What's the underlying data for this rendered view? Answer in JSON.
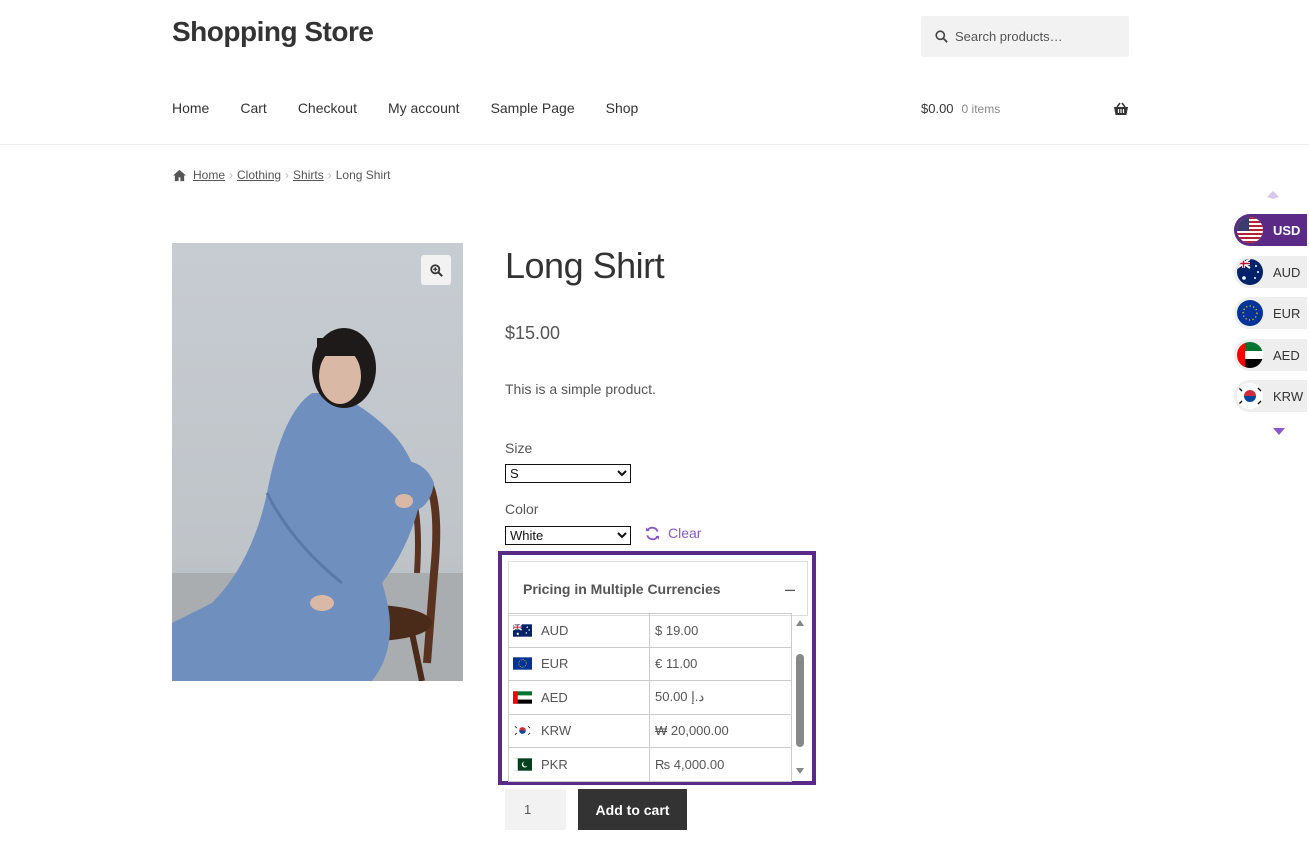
{
  "site": {
    "title": "Shopping Store"
  },
  "search": {
    "placeholder": "Search products…"
  },
  "nav": {
    "items": [
      "Home",
      "Cart",
      "Checkout",
      "My account",
      "Sample Page",
      "Shop"
    ]
  },
  "cart": {
    "amount": "$0.00",
    "count": "0 items"
  },
  "breadcrumb": {
    "home": "Home",
    "cat1": "Clothing",
    "cat2": "Shirts",
    "current": "Long Shirt"
  },
  "product": {
    "title": "Long Shirt",
    "price": "$15.00",
    "description": "This is a simple product.",
    "size_label": "Size",
    "size_value": "S",
    "color_label": "Color",
    "color_value": "White",
    "clear_label": "Clear",
    "quantity": "1",
    "add_to_cart": "Add to cart"
  },
  "pricing": {
    "heading": "Pricing in Multiple Currencies",
    "toggle": "–",
    "rows": [
      {
        "code": "AUD",
        "value": "$ 19.00"
      },
      {
        "code": "EUR",
        "value": "€ 11.00"
      },
      {
        "code": "AED",
        "value": "50.00 د.إ"
      },
      {
        "code": "KRW",
        "value": "₩ 20,000.00"
      },
      {
        "code": "PKR",
        "value": "₨ 4,000.00"
      }
    ]
  },
  "currency_switcher": {
    "items": [
      {
        "code": "USD",
        "active": true
      },
      {
        "code": "AUD",
        "active": false
      },
      {
        "code": "EUR",
        "active": false
      },
      {
        "code": "AED",
        "active": false
      },
      {
        "code": "KRW",
        "active": false
      }
    ]
  },
  "colors": {
    "accent": "#5b2a86",
    "link_purple": "#8b57c8",
    "button_dark": "#333333"
  }
}
